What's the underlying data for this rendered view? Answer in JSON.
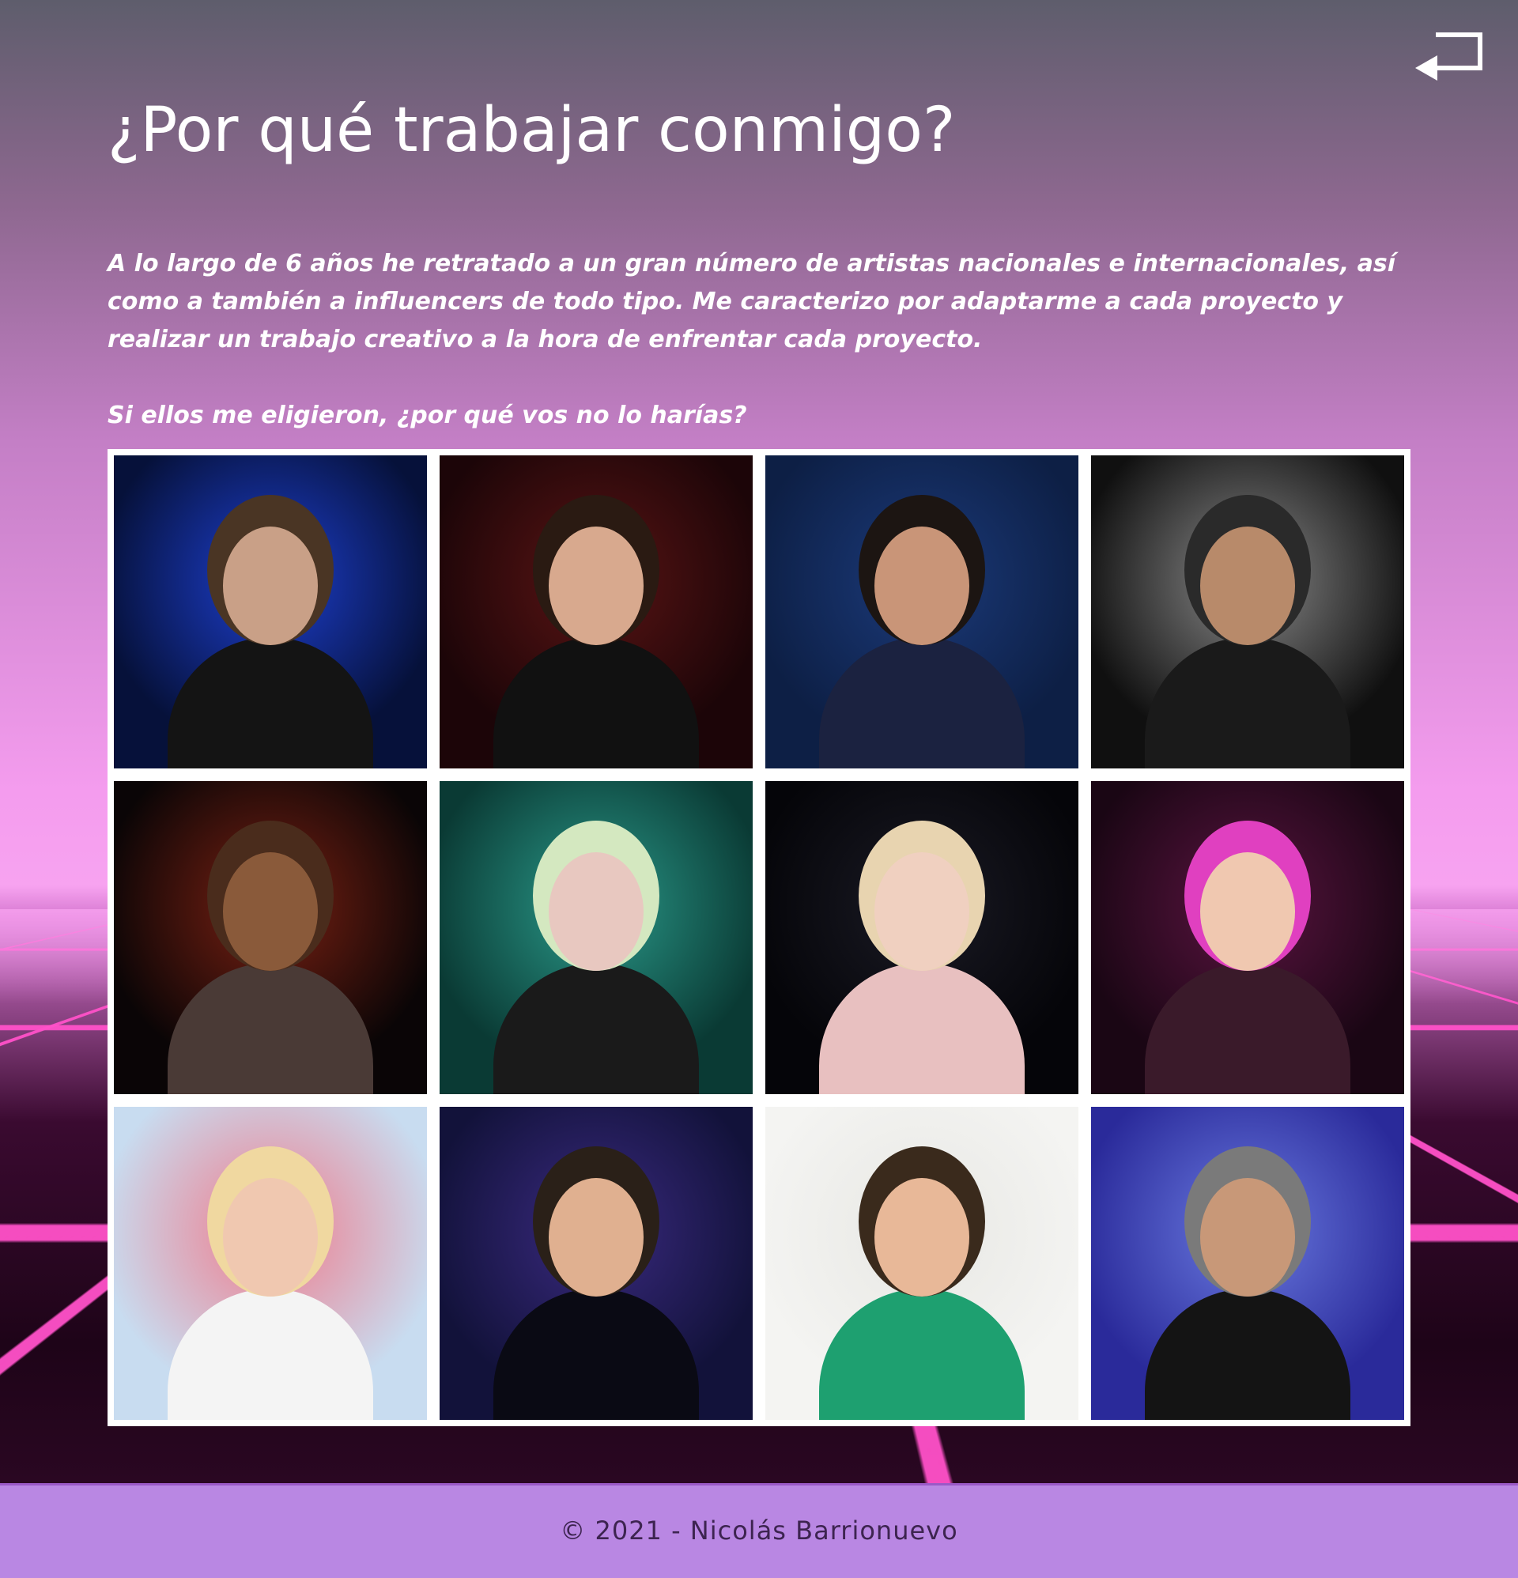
{
  "header": {
    "title": "¿Por qué trabajar conmigo?",
    "back_icon": "return-arrow-icon"
  },
  "intro": {
    "paragraph": "A lo largo de 6 años he retratado a un gran número de artistas nacionales e internacionales, así como a también a influencers de todo tipo. Me caracterizo por adaptarme a cada proyecto y realizar un trabajo creativo a la hora de enfrentar cada proyecto.",
    "question": "Si ellos me eligieron, ¿por qué vos no lo harías?"
  },
  "gallery": {
    "photos": [
      {
        "name": "portrait-bearded-man",
        "bg": "#06113a",
        "accent": "#1d3fd0",
        "skin": "#c9a087",
        "hair": "#4a3524",
        "cloth": "#141414"
      },
      {
        "name": "portrait-leather-jacket",
        "bg": "#1c0508",
        "accent": "#5a1414",
        "skin": "#d8a98e",
        "hair": "#2a1a12",
        "cloth": "#111111"
      },
      {
        "name": "portrait-sunglasses",
        "bg": "#0d1f45",
        "accent": "#1b3a7a",
        "skin": "#c99578",
        "hair": "#1c1512",
        "cloth": "#1b2240"
      },
      {
        "name": "concert-guitarist",
        "bg": "#101010",
        "accent": "#8a8a8a",
        "skin": "#b88a6a",
        "hair": "#2a2a2a",
        "cloth": "#1a1a1a"
      },
      {
        "name": "horror-mask",
        "bg": "#0a0506",
        "accent": "#7a2012",
        "skin": "#8a5a3a",
        "hair": "#4a2c1c",
        "cloth": "#4a3a36"
      },
      {
        "name": "white-hair-hand-face",
        "bg": "#0a3a34",
        "accent": "#2a9a8a",
        "skin": "#e8c8c0",
        "hair": "#d4e8c0",
        "cloth": "#1a1a1a"
      },
      {
        "name": "blonde-pink-hoodie",
        "bg": "#050509",
        "accent": "#1a1a24",
        "skin": "#f0d0c0",
        "hair": "#e8d4b0",
        "cloth": "#e8c0c0"
      },
      {
        "name": "rainbow-hair-smile",
        "bg": "#1a0614",
        "accent": "#5a1440",
        "skin": "#f0c8b0",
        "hair": "#e040c0",
        "cloth": "#3a1a2a"
      },
      {
        "name": "smoke-flares-outdoor",
        "bg": "#c8dcf0",
        "accent": "#f07a8a",
        "skin": "#f0c8b0",
        "hair": "#f0d8a0",
        "cloth": "#f4f4f4"
      },
      {
        "name": "portrait-hand-chin",
        "bg": "#12123a",
        "accent": "#3a2a80",
        "skin": "#e0b090",
        "hair": "#2a2018",
        "cloth": "#0a0a14"
      },
      {
        "name": "green-sweater-point",
        "bg": "#f4f4f2",
        "accent": "#e8e8e4",
        "skin": "#e8b898",
        "hair": "#3a2a1c",
        "cloth": "#1ea070"
      },
      {
        "name": "concert-blue-stage",
        "bg": "#2a2a9a",
        "accent": "#6a7ae0",
        "skin": "#c89878",
        "hair": "#7a7a7a",
        "cloth": "#141414"
      }
    ]
  },
  "footer": {
    "text": "© 2021 - Nicolás Barrionuevo"
  }
}
